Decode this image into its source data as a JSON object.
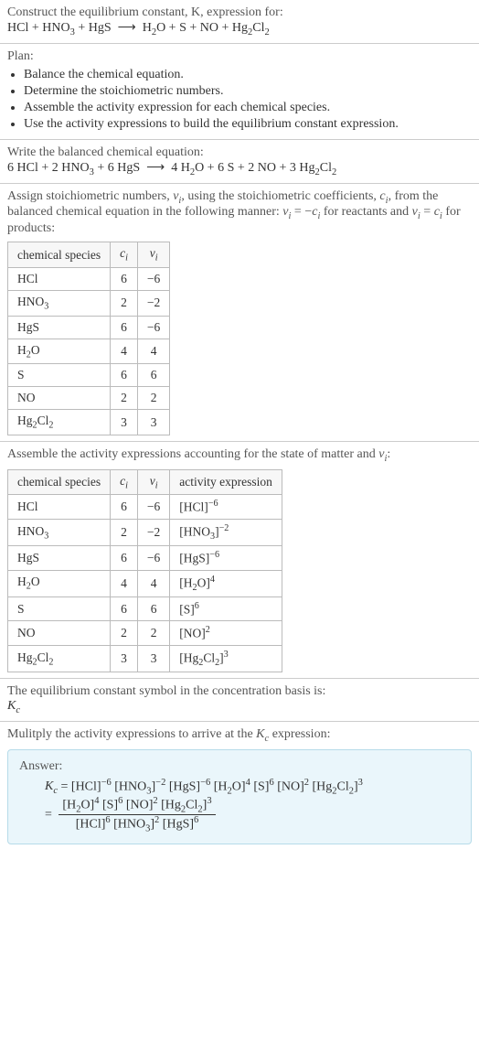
{
  "intro": {
    "line1": "Construct the equilibrium constant, K, expression for:",
    "reaction_html": "HCl + HNO<sub>3</sub> + HgS &nbsp;⟶&nbsp; H<sub>2</sub>O + S + NO + Hg<sub>2</sub>Cl<sub>2</sub>"
  },
  "plan": {
    "title": "Plan:",
    "items": [
      "Balance the chemical equation.",
      "Determine the stoichiometric numbers.",
      "Assemble the activity expression for each chemical species.",
      "Use the activity expressions to build the equilibrium constant expression."
    ]
  },
  "balanced": {
    "title": "Write the balanced chemical equation:",
    "eqn_html": "6 HCl + 2 HNO<sub>3</sub> + 6 HgS &nbsp;⟶&nbsp; 4 H<sub>2</sub>O + 6 S + 2 NO + 3 Hg<sub>2</sub>Cl<sub>2</sub>"
  },
  "stoich": {
    "intro_html": "Assign stoichiometric numbers, <span class='italic'>ν<sub>i</sub></span>, using the stoichiometric coefficients, <span class='italic'>c<sub>i</sub></span>, from the balanced chemical equation in the following manner: <span class='italic'>ν<sub>i</sub></span> = −<span class='italic'>c<sub>i</sub></span> for reactants and <span class='italic'>ν<sub>i</sub></span> = <span class='italic'>c<sub>i</sub></span> for products:",
    "headers": {
      "species": "chemical species",
      "ci_html": "<span class='italic'>c<sub>i</sub></span>",
      "vi_html": "<span class='italic'>ν<sub>i</sub></span>"
    },
    "rows": [
      {
        "species_html": "HCl",
        "ci": "6",
        "vi": "−6"
      },
      {
        "species_html": "HNO<sub>3</sub>",
        "ci": "2",
        "vi": "−2"
      },
      {
        "species_html": "HgS",
        "ci": "6",
        "vi": "−6"
      },
      {
        "species_html": "H<sub>2</sub>O",
        "ci": "4",
        "vi": "4"
      },
      {
        "species_html": "S",
        "ci": "6",
        "vi": "6"
      },
      {
        "species_html": "NO",
        "ci": "2",
        "vi": "2"
      },
      {
        "species_html": "Hg<sub>2</sub>Cl<sub>2</sub>",
        "ci": "3",
        "vi": "3"
      }
    ]
  },
  "activity": {
    "intro_html": "Assemble the activity expressions accounting for the state of matter and <span class='italic'>ν<sub>i</sub></span>:",
    "headers": {
      "species": "chemical species",
      "ci_html": "<span class='italic'>c<sub>i</sub></span>",
      "vi_html": "<span class='italic'>ν<sub>i</sub></span>",
      "act": "activity expression"
    },
    "rows": [
      {
        "species_html": "HCl",
        "ci": "6",
        "vi": "−6",
        "act_html": "[HCl]<sup>−6</sup>"
      },
      {
        "species_html": "HNO<sub>3</sub>",
        "ci": "2",
        "vi": "−2",
        "act_html": "[HNO<sub>3</sub>]<sup>−2</sup>"
      },
      {
        "species_html": "HgS",
        "ci": "6",
        "vi": "−6",
        "act_html": "[HgS]<sup>−6</sup>"
      },
      {
        "species_html": "H<sub>2</sub>O",
        "ci": "4",
        "vi": "4",
        "act_html": "[H<sub>2</sub>O]<sup>4</sup>"
      },
      {
        "species_html": "S",
        "ci": "6",
        "vi": "6",
        "act_html": "[S]<sup>6</sup>"
      },
      {
        "species_html": "NO",
        "ci": "2",
        "vi": "2",
        "act_html": "[NO]<sup>2</sup>"
      },
      {
        "species_html": "Hg<sub>2</sub>Cl<sub>2</sub>",
        "ci": "3",
        "vi": "3",
        "act_html": "[Hg<sub>2</sub>Cl<sub>2</sub>]<sup>3</sup>"
      }
    ]
  },
  "kc_symbol": {
    "line1": "The equilibrium constant symbol in the concentration basis is:",
    "line2_html": "<span class='italic'>K<sub>c</sub></span>"
  },
  "final": {
    "intro_html": "Mulitply the activity expressions to arrive at the <span class='italic'>K<sub>c</sub></span> expression:",
    "answer_label": "Answer:",
    "expr_line1_html": "<span class='italic'>K<sub>c</sub></span> = [HCl]<sup>−6</sup> [HNO<sub>3</sub>]<sup>−2</sup> [HgS]<sup>−6</sup> [H<sub>2</sub>O]<sup>4</sup> [S]<sup>6</sup> [NO]<sup>2</sup> [Hg<sub>2</sub>Cl<sub>2</sub>]<sup>3</sup>",
    "expr_frac_num_html": "[H<sub>2</sub>O]<sup>4</sup> [S]<sup>6</sup> [NO]<sup>2</sup> [Hg<sub>2</sub>Cl<sub>2</sub>]<sup>3</sup>",
    "expr_frac_den_html": "[HCl]<sup>6</sup> [HNO<sub>3</sub>]<sup>2</sup> [HgS]<sup>6</sup>",
    "eq_sign": "="
  },
  "chart_data": {
    "type": "table",
    "tables": [
      {
        "name": "stoichiometric_numbers",
        "columns": [
          "chemical species",
          "c_i",
          "ν_i"
        ],
        "rows": [
          [
            "HCl",
            6,
            -6
          ],
          [
            "HNO3",
            2,
            -2
          ],
          [
            "HgS",
            6,
            -6
          ],
          [
            "H2O",
            4,
            4
          ],
          [
            "S",
            6,
            6
          ],
          [
            "NO",
            2,
            2
          ],
          [
            "Hg2Cl2",
            3,
            3
          ]
        ]
      },
      {
        "name": "activity_expressions",
        "columns": [
          "chemical species",
          "c_i",
          "ν_i",
          "activity expression"
        ],
        "rows": [
          [
            "HCl",
            6,
            -6,
            "[HCl]^-6"
          ],
          [
            "HNO3",
            2,
            -2,
            "[HNO3]^-2"
          ],
          [
            "HgS",
            6,
            -6,
            "[HgS]^-6"
          ],
          [
            "H2O",
            4,
            4,
            "[H2O]^4"
          ],
          [
            "S",
            6,
            6,
            "[S]^6"
          ],
          [
            "NO",
            2,
            2,
            "[NO]^2"
          ],
          [
            "Hg2Cl2",
            3,
            3,
            "[Hg2Cl2]^3"
          ]
        ]
      }
    ]
  }
}
